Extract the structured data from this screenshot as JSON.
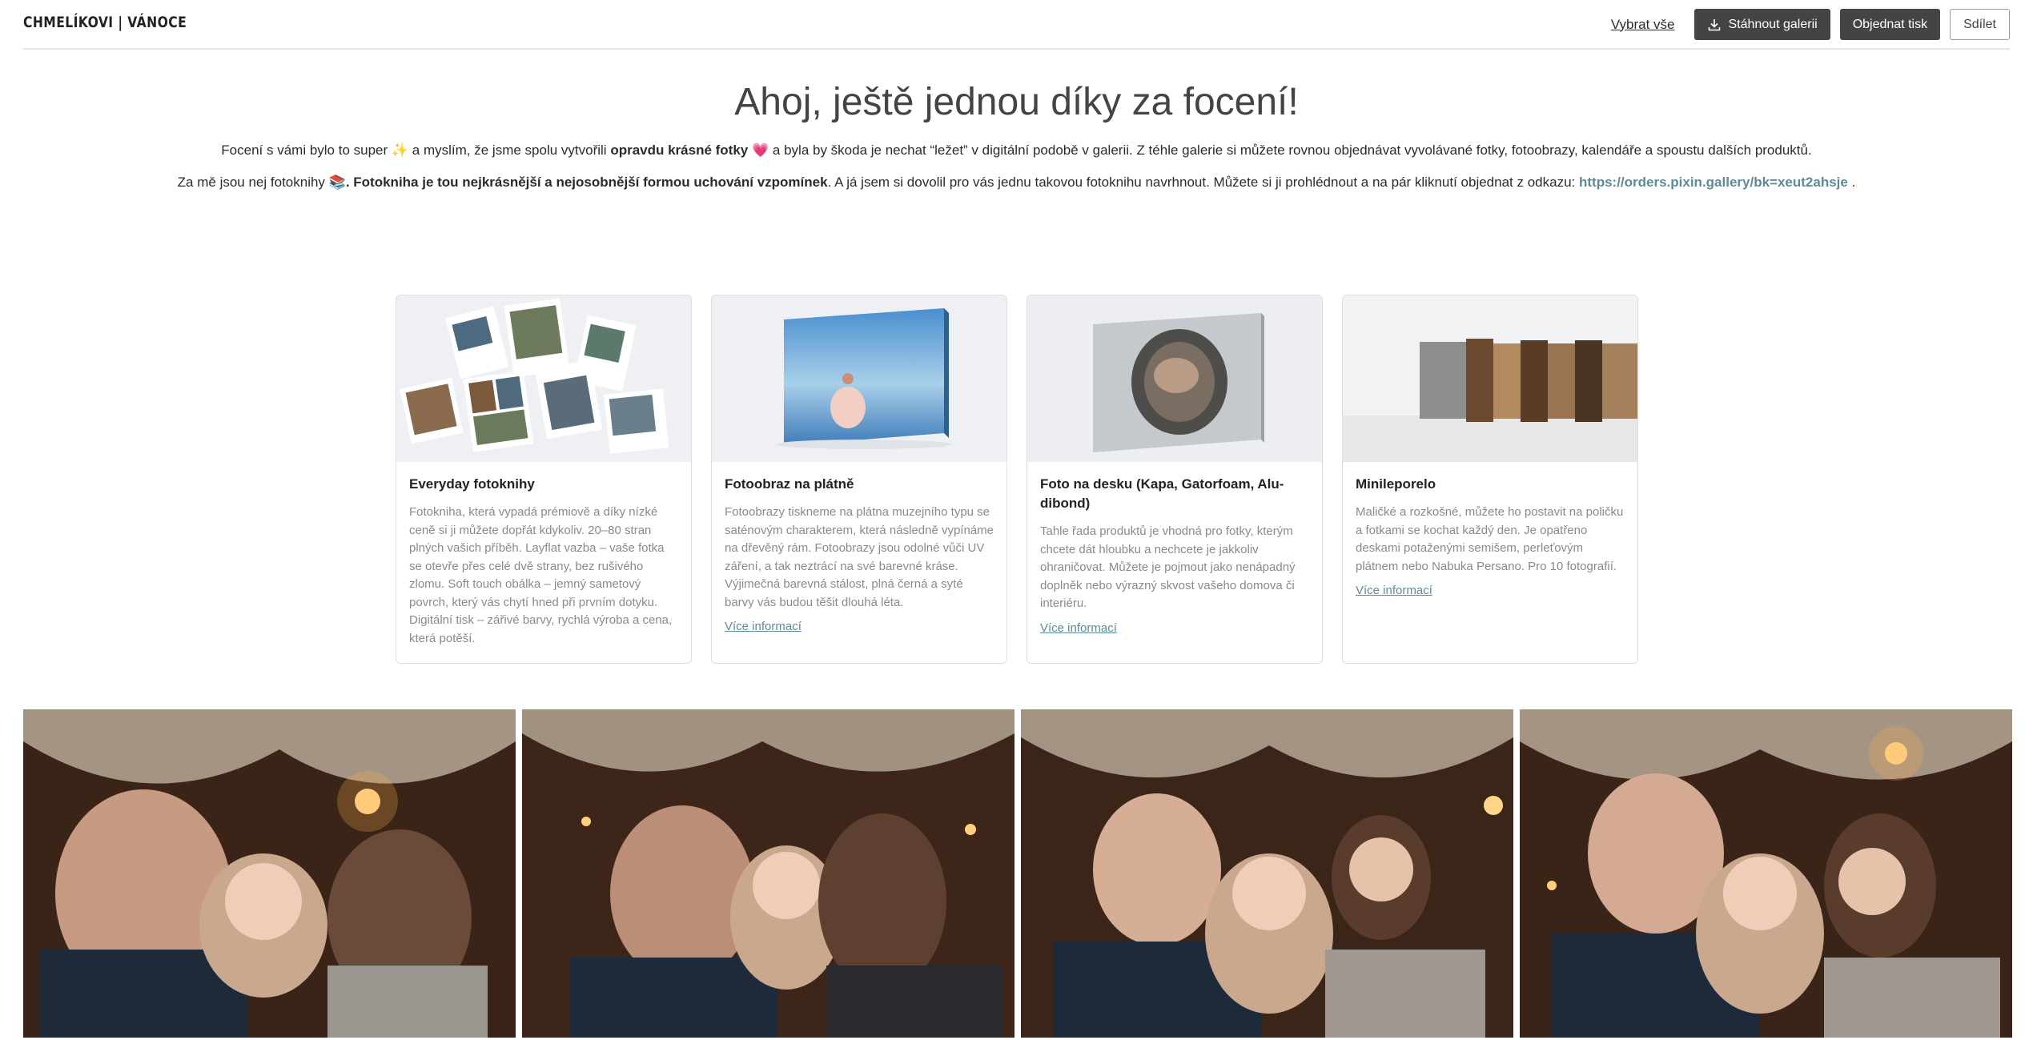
{
  "header": {
    "brand": "CHMELÍKOVI | VÁNOCE",
    "select_all": "Vybrat vše",
    "download": "Stáhnout galerii",
    "order_print": "Objednat tisk",
    "share": "Sdílet"
  },
  "intro": {
    "headline": "Ahoj, ještě jednou díky za focení!",
    "p1_a": "Focení s vámi bylo to super",
    "p1_emoji1": "✨",
    "p1_b": "a myslím, že jsme spolu vytvořili",
    "p1_bold": "opravdu krásné fotky",
    "p1_emoji2": "💗",
    "p1_c": "a byla by škoda je nechat “ležet” v digitální podobě v galerii. Z téhle galerie si můžete rovnou objednávat vyvolávané fotky, fotoobrazy, kalendáře a spoustu dalších produktů.",
    "p2_a": "Za mě jsou nej fotoknihy",
    "p2_emoji": "📚",
    "p2_bold": ". Fotokniha je tou nejkrásnější a nejosobnější formou uchování vzpomínek",
    "p2_b": ". A já jsem si dovolil pro vás jednu takovou fotoknihu navrhnout. Můžete si ji prohlédnout a na pár kliknutí objednat z odkazu:",
    "p2_link": "https://orders.pixin.gallery/bk=xeut2ahsje",
    "p2_end": "."
  },
  "products": [
    {
      "title": "Everyday fotoknihy",
      "desc": "Fotokniha, která vypadá prémiově a díky nízké ceně si ji můžete dopřát kdykoliv. 20–80 stran plných vašich příběh. Layflat vazba – vaše fotka se otevře přes celé dvě strany, bez rušivého zlomu. Soft touch obálka – jemný sametový povrch, který vás chytí hned při prvním dotyku. Digitální tisk – zářivé barvy, rychlá výroba a cena, která potěší.",
      "more": ""
    },
    {
      "title": "Fotoobraz na plátně",
      "desc": "Fotoobrazy tiskneme na plátna muzejního typu se saténovým charakterem, která následně vypínáme na dřevěný rám. Fotoobrazy jsou odolné vůči UV záření, a tak neztrácí na své barevné kráse. Výjimečná barevná stálost, plná černá a syté barvy vás budou těšit dlouhá léta.",
      "more": "Více informací"
    },
    {
      "title": "Foto na desku (Kapa, Gatorfoam, Alu-dibond)",
      "desc": "Tahle řada produktů je vhodná pro fotky, kterým chcete dát hloubku a nechcete je jakkoliv ohraničovat. Můžete je pojmout jako nenápadný doplněk nebo výrazný skvost vašeho domova či interiéru.",
      "more": "Více informací"
    },
    {
      "title": "Minileporelo",
      "desc": "Maličké a rozkošné, můžete ho postavit na poličku a fotkami se kochat každý den. Je opatřeno deskami potaženými semišem, perleťovým plátnem nebo Nabuka Persano. Pro 10 fotografií.",
      "more": "Více informací"
    }
  ],
  "colors": {
    "button_dark": "#444444",
    "link": "#5e8a98",
    "photo_warm": "#3a2418"
  }
}
